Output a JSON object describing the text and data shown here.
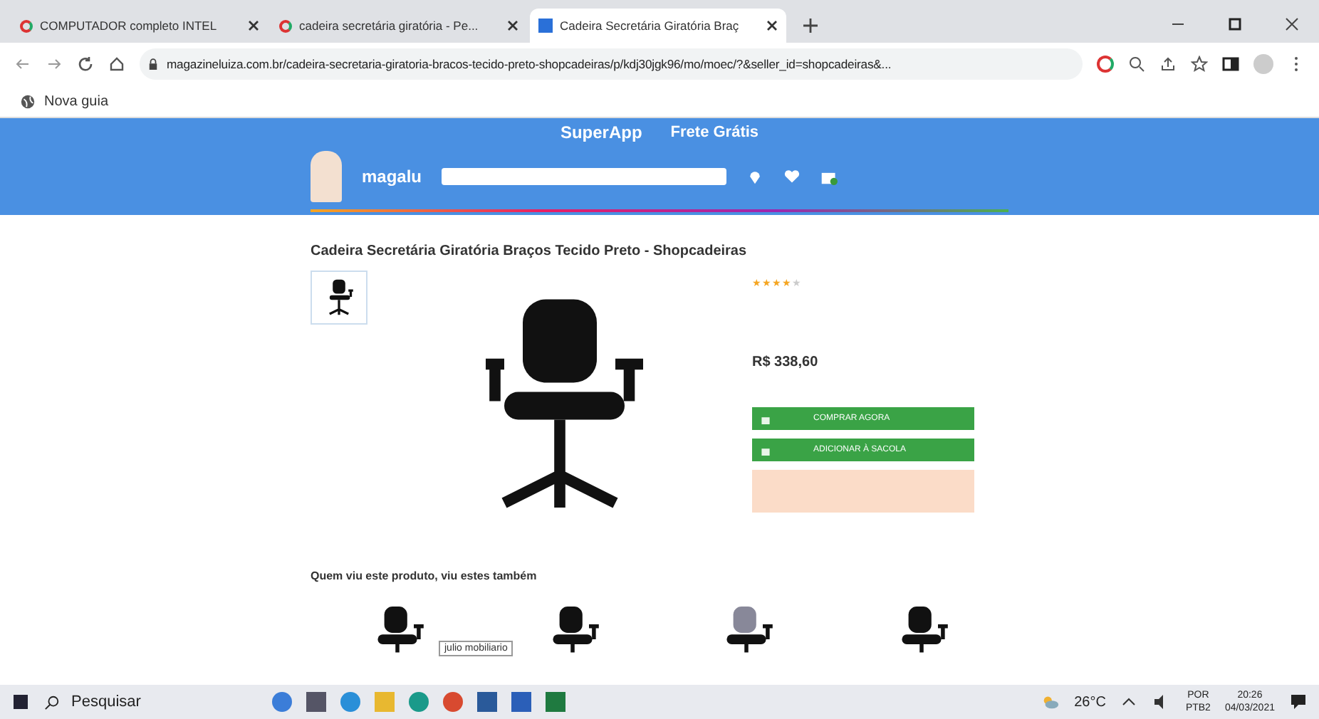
{
  "browser": {
    "tabs": [
      {
        "title": "COMPUTADOR completo INTEL",
        "selected": false
      },
      {
        "title": "cadeira secretária giratória - Pe...",
        "selected": false
      },
      {
        "title": "Cadeira Secretária Giratória Braç",
        "selected": true
      }
    ],
    "url": "magazineluiza.com.br/cadeira-secretaria-giratoria-bracos-tecido-preto-shopcadeiras/p/kdj30jgk96/mo/moec/?&seller_id=shopcadeiras&...",
    "bookmark": "Nova guia"
  },
  "header": {
    "superapp": "SuperApp",
    "shipping": "Frete Grátis",
    "logo": "magalu"
  },
  "product": {
    "title": "Cadeira Secretária Giratória Braços Tecido Preto - Shopcadeiras",
    "stars": 4,
    "price": "R$ 338,60",
    "buttons": [
      {
        "label": "COMPRAR AGORA"
      },
      {
        "label": "ADICIONAR À SACOLA"
      }
    ]
  },
  "recommendations": {
    "heading": "Quem viu este produto, viu estes também",
    "tooltip": "julio mobiliario"
  },
  "taskbar": {
    "search": "Pesquisar",
    "weather": "26°C",
    "lang": "POR",
    "layout": "PTB2",
    "time": "20:26",
    "date": "04/03/2021"
  }
}
